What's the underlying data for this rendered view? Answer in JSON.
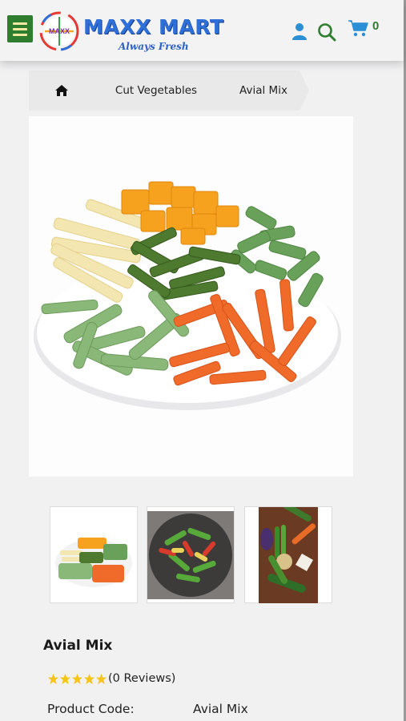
{
  "header": {
    "brand_name": "MAXX MART",
    "brand_tagline": "Always Fresh",
    "logo_inner_text": "MAXX",
    "cart_count": "0",
    "icons": [
      "menu-icon",
      "user-icon",
      "search-icon",
      "cart-icon"
    ]
  },
  "breadcrumb": {
    "home_icon": "home-icon",
    "category": "Cut Vegetables",
    "current": "Avial Mix"
  },
  "product": {
    "main_image_alt": "Avial Mix",
    "thumbnails": [
      "thumbnail-platter",
      "thumbnail-wok",
      "thumbnail-raw-vegetables"
    ],
    "title": "Avial Mix",
    "rating_stars": 5,
    "reviews_text": "(0 Reviews)",
    "code_label": "Product Code:",
    "code_value": "Avial Mix"
  },
  "colors": {
    "brand_green": "#2f7d2e",
    "brand_blue": "#2e6fd8",
    "star_yellow": "#f5c518",
    "icon_blue": "#2b8fd6"
  }
}
